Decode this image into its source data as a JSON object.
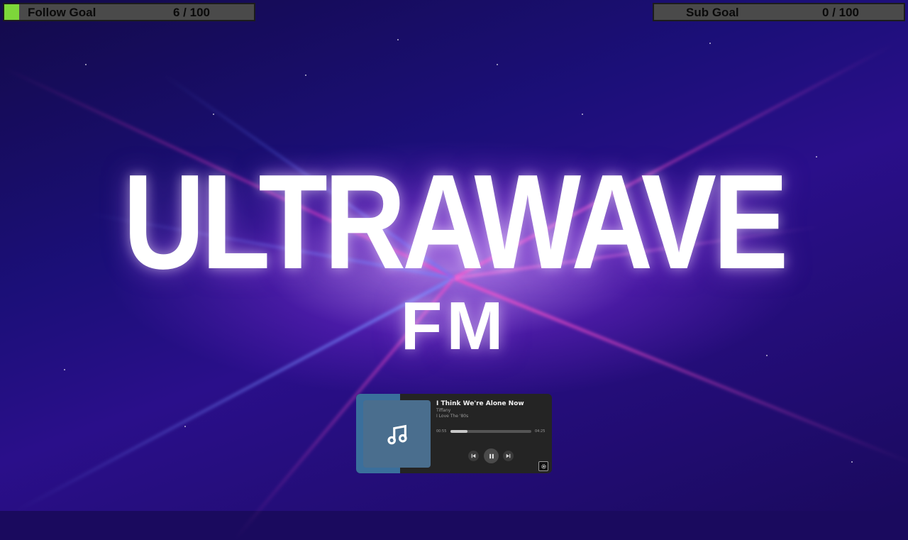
{
  "follow_goal": {
    "label": "Follow Goal",
    "count": "6 / 100",
    "progress": 0.06,
    "fill_color": "#7dd63a"
  },
  "sub_goal": {
    "label": "Sub Goal",
    "count": "0 / 100",
    "progress": 0.0,
    "fill_color": "#7dd63a"
  },
  "title": {
    "main": "ULTRAWAVE",
    "sub": "FM"
  },
  "player": {
    "song": "I Think We're Alone Now",
    "artist": "Tiffany",
    "album": "I Love The '80s",
    "current_time": "00:55",
    "total_time": "04:25",
    "progress": 0.21,
    "icons": {
      "art": "music-note-icon",
      "prev": "skip-previous-icon",
      "play": "pause-icon",
      "next": "skip-next-icon",
      "settings": "gear-icon"
    }
  }
}
